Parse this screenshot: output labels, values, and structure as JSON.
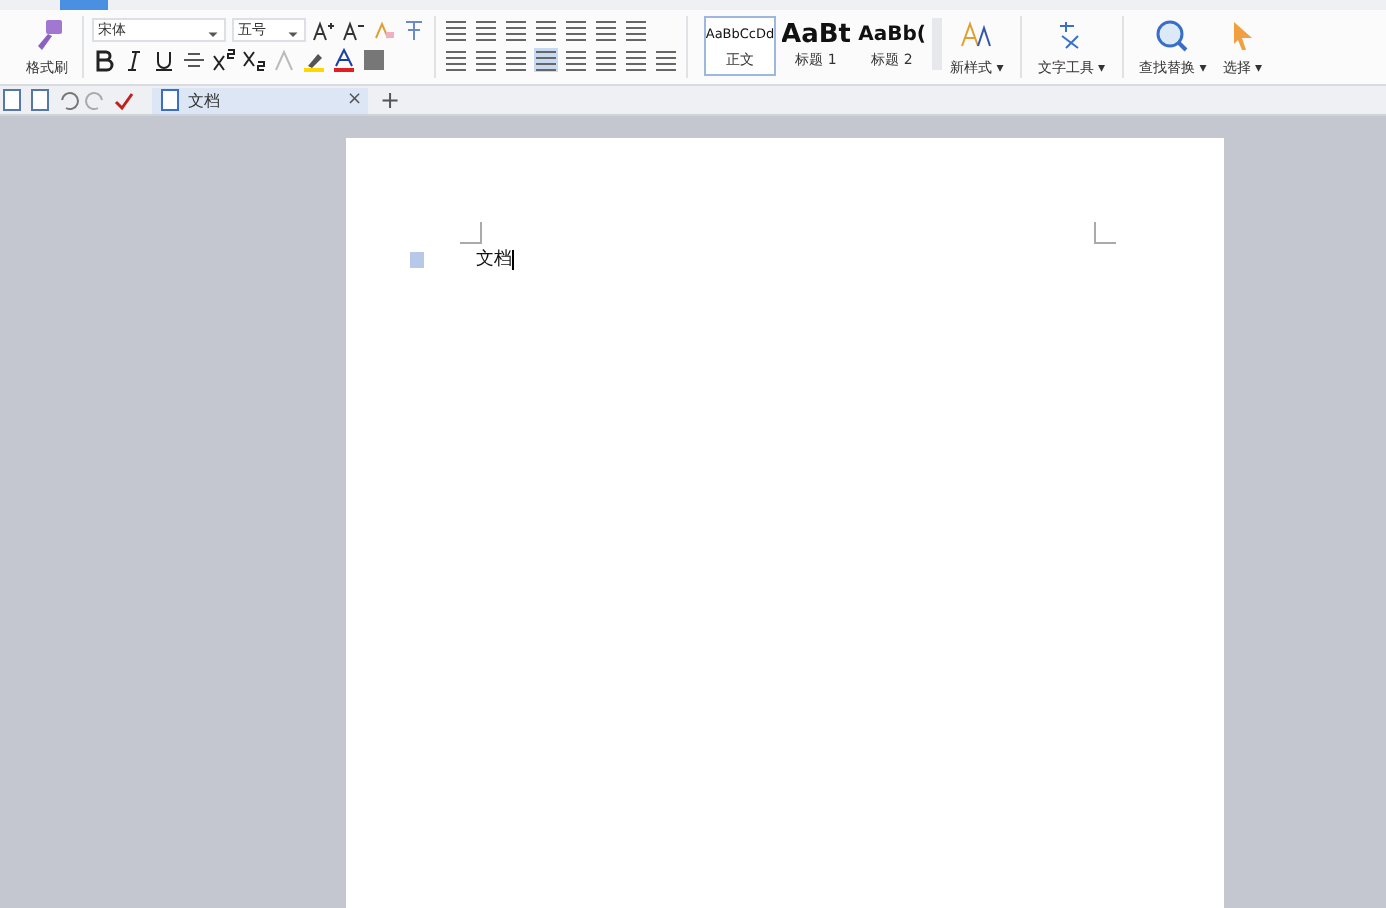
{
  "ribbon": {
    "format_painter": "格式刷",
    "font": {
      "value": "宋体"
    },
    "size": {
      "value": "五号"
    },
    "styles": [
      {
        "sample": "AaBbCcDd",
        "label": "正文",
        "selected": true,
        "kind": "small"
      },
      {
        "sample": "AaBt",
        "label": "标题 1",
        "selected": false,
        "kind": "large"
      },
      {
        "sample": "AaBb(",
        "label": "标题 2",
        "selected": false,
        "kind": "medium"
      }
    ],
    "tools": [
      {
        "label": "新样式 ▾",
        "kind": "newstyle"
      },
      {
        "label": "文字工具 ▾",
        "kind": "text"
      },
      {
        "label": "查找替换 ▾",
        "kind": "find"
      },
      {
        "label": "选择 ▾",
        "kind": "select"
      }
    ]
  },
  "doc_tab": {
    "title": "文档",
    "close": "×",
    "add": "+"
  },
  "page": {
    "text": "文档"
  }
}
